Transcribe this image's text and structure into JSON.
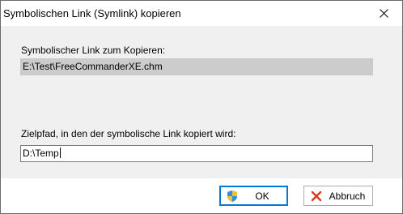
{
  "window": {
    "title": "Symbolischen Link (Symlink) kopieren",
    "close_icon": "close-icon"
  },
  "form": {
    "source_label": "Symbolischer Link zum Kopieren:",
    "source_value": "E:\\Test\\FreeCommanderXE.chm",
    "target_label": "Zielpfad, in den der symbolische Link kopiert wird:",
    "target_value": "D:\\Temp"
  },
  "buttons": {
    "ok_label": "OK",
    "ok_icon": "uac-shield-icon",
    "cancel_label": "Abbruch",
    "cancel_icon": "red-x-icon"
  },
  "colors": {
    "content_background": "#f0f0f0",
    "readonly_field": "#cccccc",
    "default_button_border": "#0078d7",
    "cancel_icon": "#d9391f"
  }
}
